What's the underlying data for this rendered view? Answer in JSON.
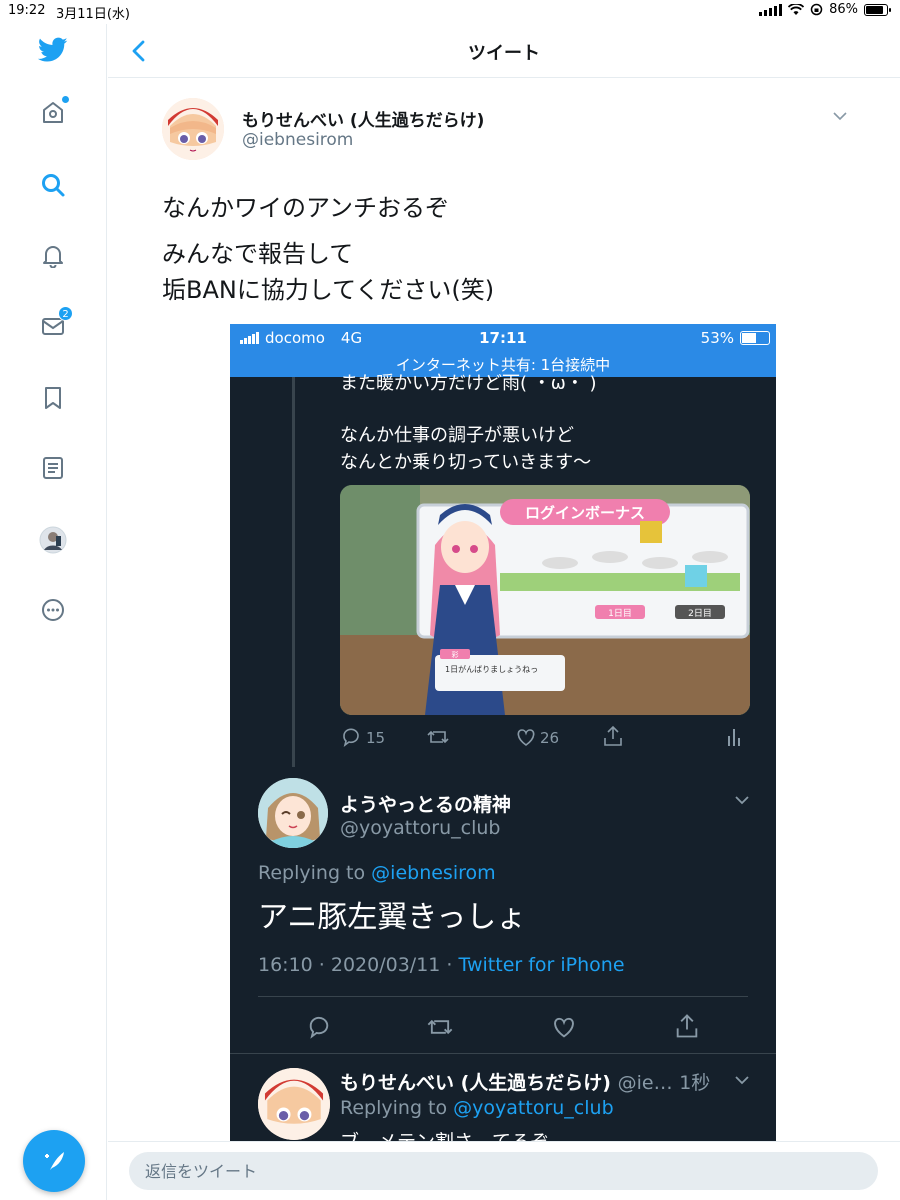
{
  "status_bar": {
    "time": "19:22",
    "date": "3月11日(水)",
    "battery": "86%"
  },
  "sidebar": {
    "items": [
      {
        "icon": "home-icon"
      },
      {
        "icon": "search-icon"
      },
      {
        "icon": "bell-icon"
      },
      {
        "icon": "mail-icon",
        "badge": "2"
      },
      {
        "icon": "bookmark-icon"
      },
      {
        "icon": "list-icon"
      },
      {
        "icon": "profile-icon"
      },
      {
        "icon": "more-icon"
      }
    ],
    "compose_icon": "compose-icon"
  },
  "header": {
    "title": "ツイート"
  },
  "tweet": {
    "name": "もりせんべい (人生過ちだらけ)",
    "handle": "@iebnesirom",
    "lines": [
      "なんかワイのアンチおるぞ",
      "みんなで報告して",
      "垢BANに協力してください(笑)"
    ]
  },
  "embedded": {
    "status": {
      "carrier": "docomo",
      "network": "4G",
      "time": "17:11",
      "battery": "53%",
      "hotspot": "インターネット共有: 1台接続中"
    },
    "quoted_text": [
      "また暖かい方だけど雨( ・ω・ )",
      "なんか仕事の調子が悪いけど",
      "なんとか乗り切っていきます〜"
    ],
    "image_overlay": {
      "banner": "ログインボーナス",
      "day1": "1日目",
      "day2": "2日目",
      "char_name": "彩",
      "speech": "1日がんばりましょうねっ"
    },
    "actions": {
      "replies": "15",
      "likes": "26"
    },
    "reply": {
      "name": "ようやっとるの精神",
      "handle": "@yoyattoru_club",
      "replying_prefix": "Replying to",
      "replying_to": "@iebnesirom",
      "text": "アニ豚左翼きっしょ",
      "timestamp": "16:10 · 2020/03/11 · ",
      "source": "Twitter for iPhone"
    },
    "reply2": {
      "name": "もりせんべい (人生過ちだらけ)",
      "handle": "@ie…",
      "time": "1秒",
      "replying_prefix": "Replying to",
      "replying_to": "@yoyattoru_club",
      "text_cut": "ブ…メテン割さ…てるぞ"
    }
  },
  "reply_bar": {
    "placeholder": "返信をツイート"
  },
  "colors": {
    "accent": "#1da1f2",
    "dark_bg": "#15202b",
    "hotspot_bar": "#2b8ae6"
  }
}
